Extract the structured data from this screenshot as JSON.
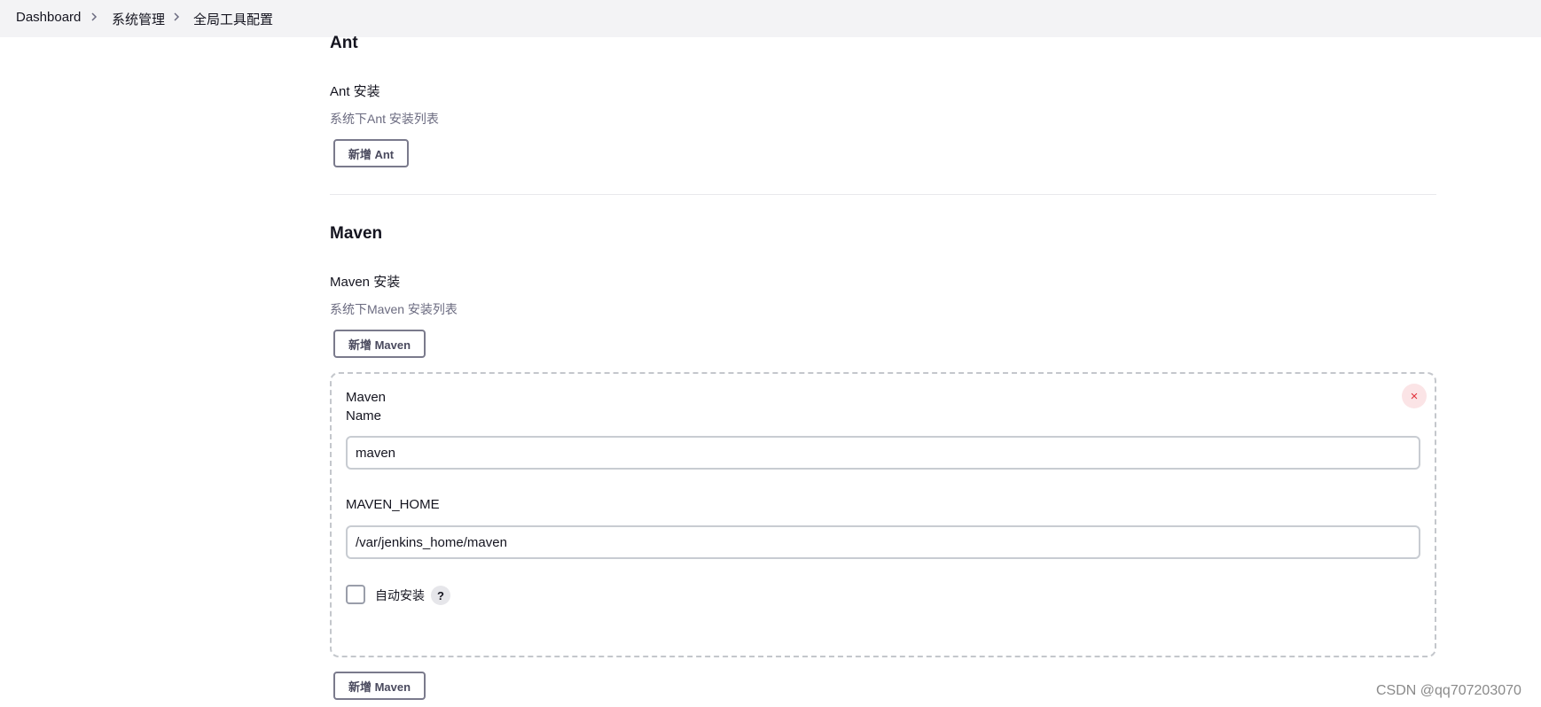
{
  "breadcrumb": {
    "items": [
      "Dashboard",
      "系统管理",
      "全局工具配置"
    ],
    "separator_icon": "chevron-right-icon"
  },
  "ant": {
    "title": "Ant",
    "install_label": "Ant 安装",
    "install_desc": "系统下Ant 安装列表",
    "add_button": "新增 Ant"
  },
  "maven": {
    "title": "Maven",
    "install_label": "Maven 安装",
    "install_desc": "系统下Maven 安装列表",
    "add_button_top": "新增 Maven",
    "add_button_bottom": "新增 Maven",
    "installation": {
      "heading": "Maven",
      "name_label": "Name",
      "name_value": "maven",
      "home_label": "MAVEN_HOME",
      "home_value": "/var/jenkins_home/maven",
      "auto_install_label": "自动安装",
      "auto_install_checked": false,
      "help_icon": "?",
      "close_icon": "×"
    }
  },
  "watermark": "CSDN @qq707203070",
  "colors": {
    "breadcrumb_bg": "#f3f3f5",
    "button_border": "#7a7a8c",
    "close_bg": "#fbe4e6",
    "close_fg": "#e0303a",
    "panel_border": "#c4c7cc"
  }
}
